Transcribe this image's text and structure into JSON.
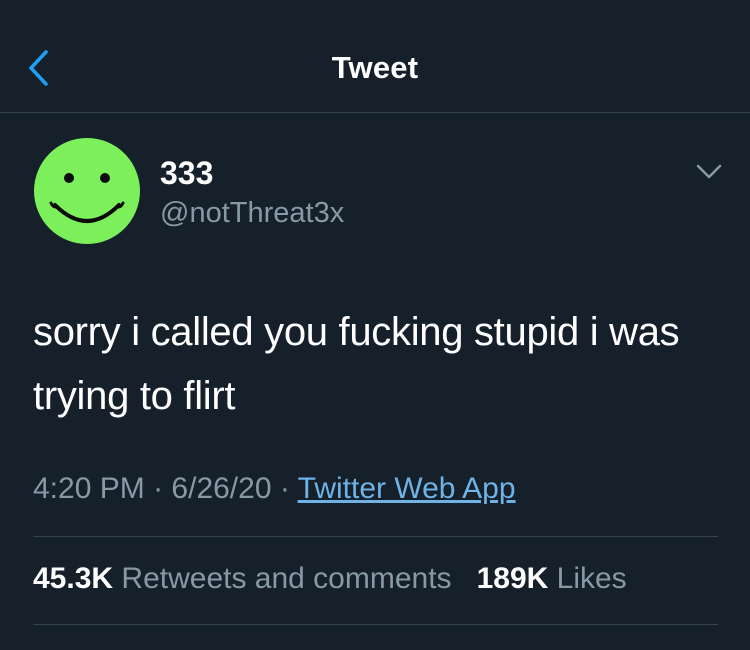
{
  "header": {
    "title": "Tweet",
    "back_icon": "chevron-left-icon"
  },
  "author": {
    "display_name": "333",
    "handle": "@notThreat3x",
    "avatar": "green-smiley-face"
  },
  "tweet": {
    "text": "sorry i called you fucking stupid i was trying to flirt",
    "time": "4:20 PM",
    "date": "6/26/20",
    "separator": "·",
    "source": "Twitter Web App"
  },
  "stats": {
    "retweets_count": "45.3K",
    "retweets_label": "Retweets and comments",
    "likes_count": "189K",
    "likes_label": "Likes"
  },
  "colors": {
    "background": "#15202b",
    "divider": "#38444d",
    "secondary_text": "#8899a6",
    "accent": "#1da1f2",
    "avatar_green": "#7cf05a"
  }
}
